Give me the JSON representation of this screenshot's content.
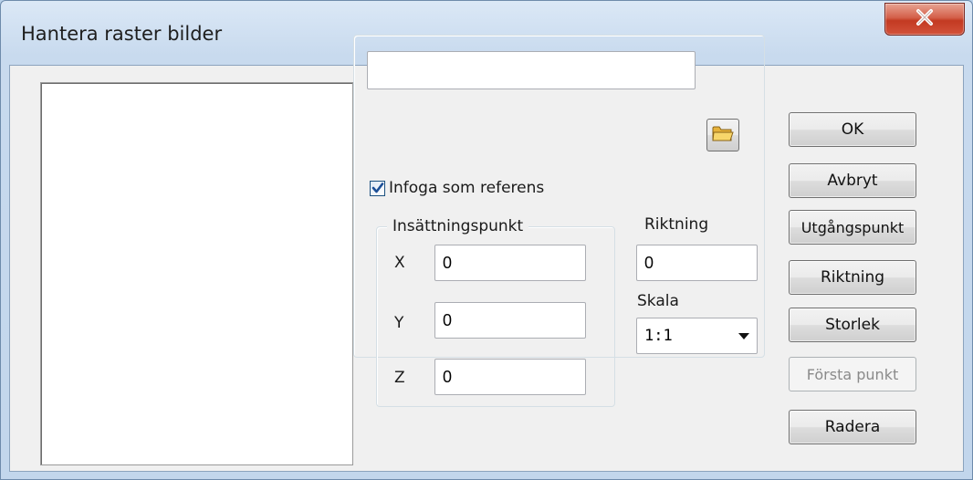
{
  "window": {
    "title": "Hantera raster bilder",
    "close_icon": "close-x-icon"
  },
  "file": {
    "path_value": "",
    "browse_icon": "folder-open-icon"
  },
  "reference": {
    "checkbox_label": "Infoga som referens",
    "checked": true
  },
  "insertion_point": {
    "group_title": "Insättningspunkt",
    "x_label": "X",
    "x_value": "0",
    "y_label": "Y",
    "y_value": "0",
    "z_label": "Z",
    "z_value": "0"
  },
  "direction": {
    "label": "Riktning",
    "value": "0"
  },
  "scale": {
    "label": "Skala",
    "selected": "1:1"
  },
  "buttons": {
    "ok": "OK",
    "cancel": "Avbryt",
    "origin": "Utgångspunkt",
    "direction": "Riktning",
    "size": "Storlek",
    "first_point": "Första punkt",
    "delete": "Radera"
  },
  "colors": {
    "close_button": "#c7412b",
    "checkbox_check": "#1c4f96",
    "folder_icon": "#e8b93c"
  }
}
